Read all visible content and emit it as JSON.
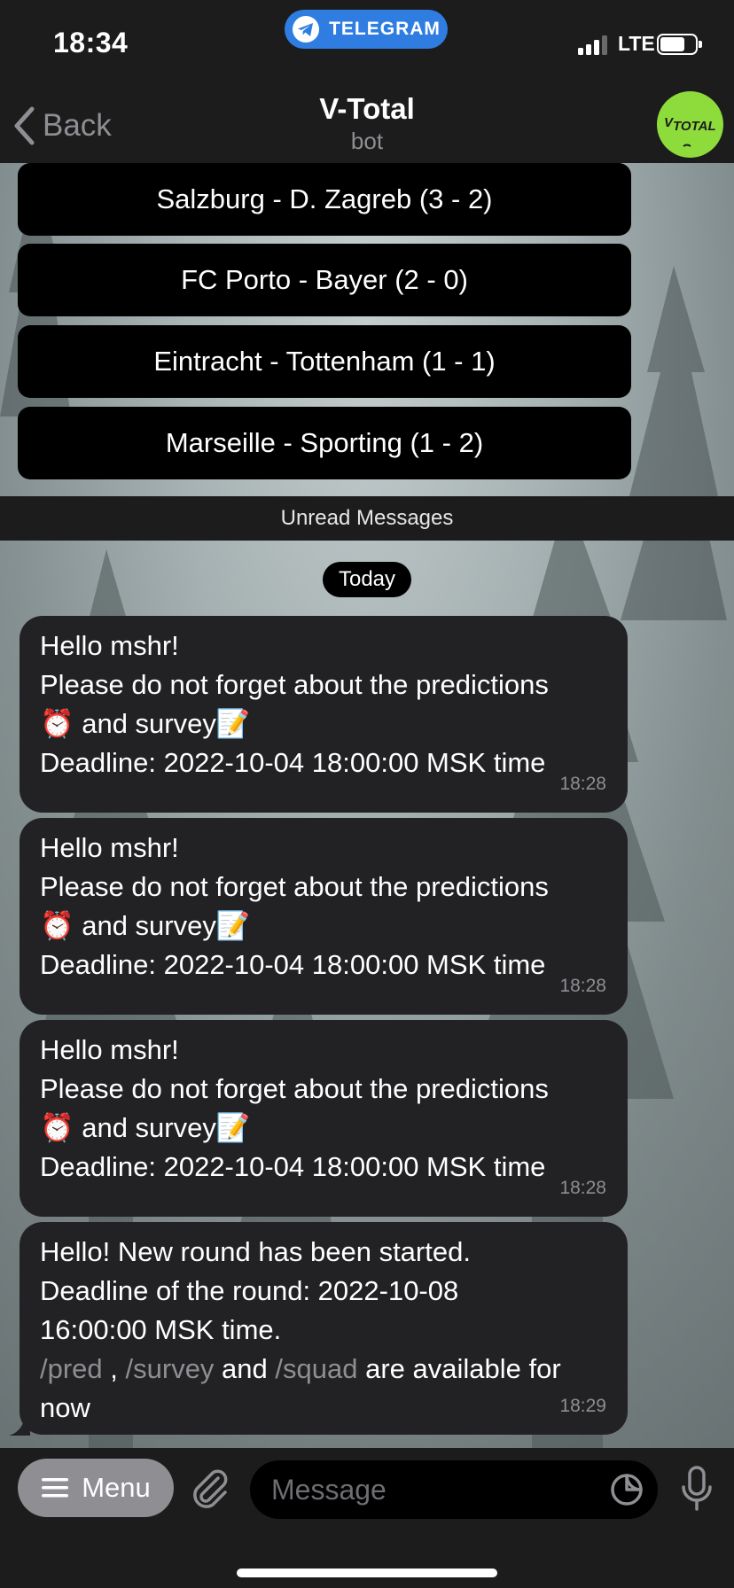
{
  "status_bar": {
    "time": "18:34",
    "pill_label": "TELEGRAM",
    "network": "LTE"
  },
  "header": {
    "back_label": "Back",
    "title": "V-Total",
    "subtitle": "bot",
    "avatar_text": "VTOTAL"
  },
  "match_buttons": [
    {
      "label": "Salzburg - D. Zagreb (3 - 2)"
    },
    {
      "label": "FC Porto - Bayer (2 - 0)"
    },
    {
      "label": "Eintracht - Tottenham (1 - 1)"
    },
    {
      "label": "Marseille - Sporting (1 - 2)"
    }
  ],
  "unread_label": "Unread Messages",
  "date_label": "Today",
  "messages": [
    {
      "greeting": "Hello mshr!",
      "line2": "Please do not forget about the predictions",
      "alarm_emoji": "⏰",
      "and_survey": " and survey",
      "memo_emoji": "📝",
      "deadline": "Deadline: 2022-10-04 18:00:00 MSK time",
      "time": "18:28"
    },
    {
      "greeting": "Hello mshr!",
      "line2": "Please do not forget about the predictions",
      "alarm_emoji": "⏰",
      "and_survey": " and survey",
      "memo_emoji": "📝",
      "deadline": "Deadline: 2022-10-04 18:00:00 MSK time",
      "time": "18:28"
    },
    {
      "greeting": "Hello mshr!",
      "line2": "Please do not forget about the predictions",
      "alarm_emoji": "⏰",
      "and_survey": " and survey",
      "memo_emoji": "📝",
      "deadline": "Deadline: 2022-10-04 18:00:00 MSK time",
      "time": "18:28"
    }
  ],
  "last_message": {
    "line1": "Hello! New round has been started.",
    "line2": "Deadline of the round: 2022-10-08",
    "line3": "16:00:00 MSK time.",
    "cmd_pred": "/pred",
    "sep1": " , ",
    "cmd_survey": "/survey",
    "and": " and ",
    "cmd_squad": "/squad",
    "tail_text": " are available for now",
    "time": "18:29"
  },
  "input_bar": {
    "menu_label": "Menu",
    "placeholder": "Message"
  },
  "colors": {
    "accent": "#2f7de1",
    "bubble": "#222224",
    "command": "#8e8e93",
    "avatar": "#8ddc3b"
  }
}
